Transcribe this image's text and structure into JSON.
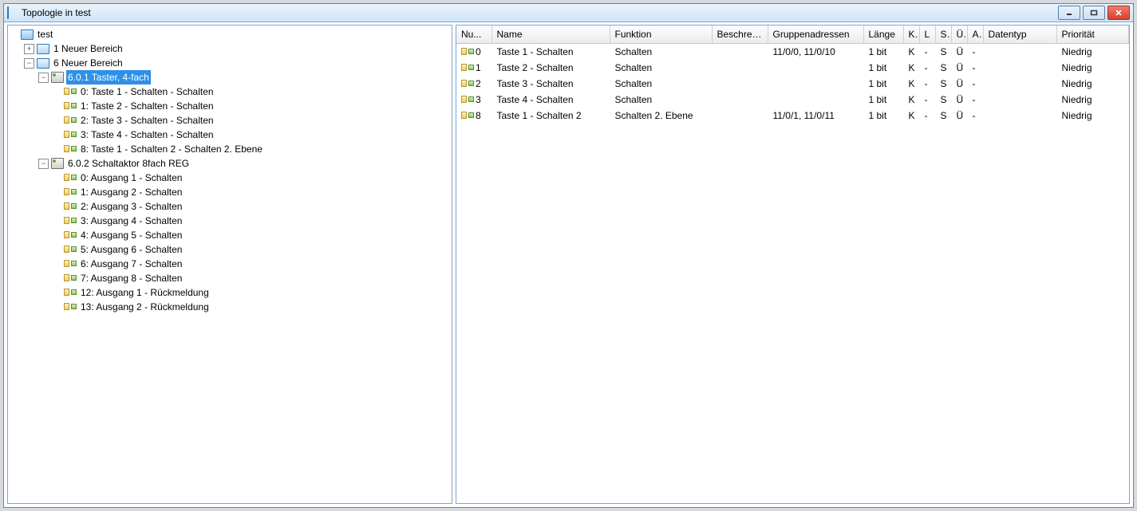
{
  "window": {
    "title": "Topologie in test"
  },
  "tree": {
    "root": {
      "label": "test"
    },
    "area1": {
      "label": "1 Neuer Bereich",
      "expander": "+"
    },
    "area6": {
      "label": "6 Neuer Bereich",
      "expander": "−"
    },
    "dev601": {
      "label": "6.0.1 Taster, 4-fach",
      "expander": "−"
    },
    "dev601_objs": [
      {
        "label": "0: Taste 1 - Schalten - Schalten"
      },
      {
        "label": "1: Taste 2 - Schalten - Schalten"
      },
      {
        "label": "2: Taste 3 - Schalten - Schalten"
      },
      {
        "label": "3: Taste 4 - Schalten - Schalten"
      },
      {
        "label": "8: Taste 1 - Schalten 2 - Schalten 2. Ebene"
      }
    ],
    "dev602": {
      "label": "6.0.2 Schaltaktor 8fach REG",
      "expander": "−"
    },
    "dev602_objs": [
      {
        "label": "0: Ausgang 1 - Schalten"
      },
      {
        "label": "1: Ausgang 2 - Schalten"
      },
      {
        "label": "2: Ausgang 3 - Schalten"
      },
      {
        "label": "3: Ausgang 4 - Schalten"
      },
      {
        "label": "4: Ausgang 5 - Schalten"
      },
      {
        "label": "5: Ausgang 6 - Schalten"
      },
      {
        "label": "6: Ausgang 7 - Schalten"
      },
      {
        "label": "7: Ausgang 8 - Schalten"
      },
      {
        "label": "12: Ausgang 1 - Rückmeldung"
      },
      {
        "label": "13: Ausgang 2 - Rückmeldung"
      }
    ]
  },
  "grid": {
    "columns": {
      "num": "Nu...",
      "name": "Name",
      "funktion": "Funktion",
      "beschreib": "Beschreib...",
      "gruppen": "Gruppenadressen",
      "laenge": "Länge",
      "k": "K",
      "l": "L",
      "s": "S",
      "u": "Ü",
      "a": "A",
      "datentyp": "Datentyp",
      "prio": "Priorität"
    },
    "rows": [
      {
        "num": "0",
        "name": "Taste 1 - Schalten",
        "funktion": "Schalten",
        "beschreib": "",
        "gruppen": "11/0/0, 11/0/10",
        "laenge": "1 bit",
        "k": "K",
        "l": "-",
        "s": "S",
        "u": "Ü",
        "a": "-",
        "datentyp": "",
        "prio": "Niedrig"
      },
      {
        "num": "1",
        "name": "Taste 2 - Schalten",
        "funktion": "Schalten",
        "beschreib": "",
        "gruppen": "",
        "laenge": "1 bit",
        "k": "K",
        "l": "-",
        "s": "S",
        "u": "Ü",
        "a": "-",
        "datentyp": "",
        "prio": "Niedrig"
      },
      {
        "num": "2",
        "name": "Taste 3 - Schalten",
        "funktion": "Schalten",
        "beschreib": "",
        "gruppen": "",
        "laenge": "1 bit",
        "k": "K",
        "l": "-",
        "s": "S",
        "u": "Ü",
        "a": "-",
        "datentyp": "",
        "prio": "Niedrig"
      },
      {
        "num": "3",
        "name": "Taste 4 - Schalten",
        "funktion": "Schalten",
        "beschreib": "",
        "gruppen": "",
        "laenge": "1 bit",
        "k": "K",
        "l": "-",
        "s": "S",
        "u": "Ü",
        "a": "-",
        "datentyp": "",
        "prio": "Niedrig"
      },
      {
        "num": "8",
        "name": "Taste 1 - Schalten 2",
        "funktion": "Schalten 2. Ebene",
        "beschreib": "",
        "gruppen": "11/0/1, 11/0/11",
        "laenge": "1 bit",
        "k": "K",
        "l": "-",
        "s": "S",
        "u": "Ü",
        "a": "-",
        "datentyp": "",
        "prio": "Niedrig"
      }
    ]
  }
}
